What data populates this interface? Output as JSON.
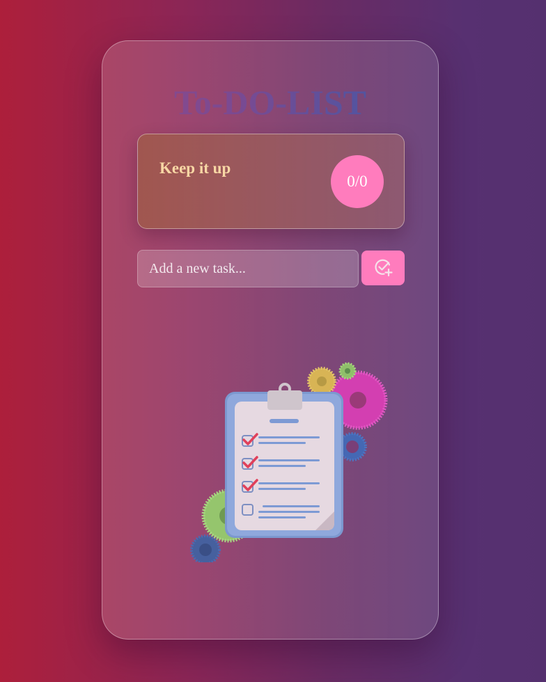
{
  "app": {
    "title": "To-DO-LIST"
  },
  "stats": {
    "message": "Keep it up",
    "progress_text": "0/0",
    "completed": 0,
    "total": 0
  },
  "task_form": {
    "placeholder": "Add a new task...",
    "value": "",
    "add_button_icon": "check-circle-plus-icon"
  },
  "empty_state": {
    "illustration": "clipboard-checklist-gears-illustration"
  },
  "colors": {
    "accent_pink": "#ff7cbd",
    "stats_text": "#f8d7a5",
    "background_left": "#ad1f3b",
    "background_right": "#55306f"
  }
}
